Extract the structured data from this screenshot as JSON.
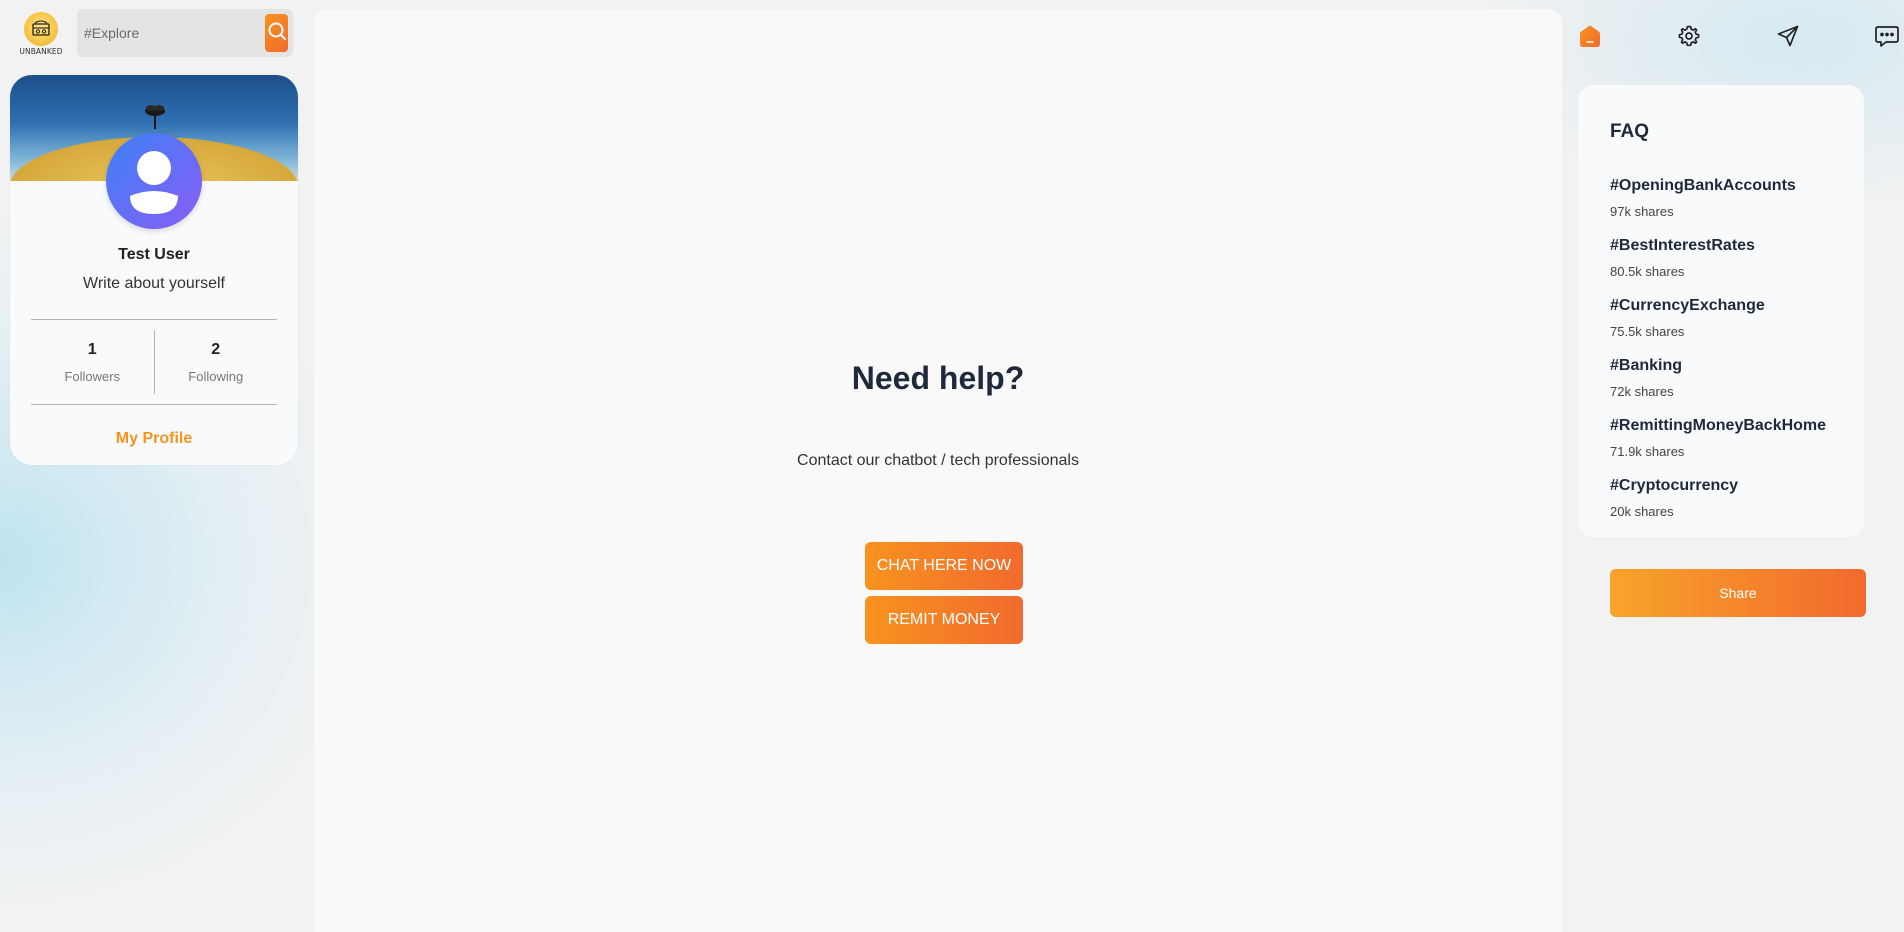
{
  "logo": {
    "text": "UNBANKED",
    "icon": "unbanked-logo"
  },
  "search": {
    "placeholder": "#Explore",
    "icon": "search-icon"
  },
  "profile": {
    "name": "Test User",
    "bio": "Write about yourself",
    "followers_count": "1",
    "followers_label": "Followers",
    "following_count": "2",
    "following_label": "Following",
    "link_label": "My Profile"
  },
  "main": {
    "title": "Need help?",
    "subtitle": "Contact our chatbot / tech professionals",
    "chat_button": "CHAT HERE NOW",
    "remit_button": "REMIT MONEY"
  },
  "top_icons": [
    "home-icon",
    "gear-icon",
    "send-icon",
    "chat-bubble-icon"
  ],
  "faq": {
    "title": "FAQ",
    "items": [
      {
        "tag": "#OpeningBankAccounts",
        "shares": "97k shares"
      },
      {
        "tag": "#BestInterestRates",
        "shares": "80.5k shares"
      },
      {
        "tag": "#CurrencyExchange",
        "shares": "75.5k shares"
      },
      {
        "tag": "#Banking",
        "shares": "72k shares"
      },
      {
        "tag": "#RemittingMoneyBackHome",
        "shares": "71.9k shares"
      },
      {
        "tag": "#Cryptocurrency",
        "shares": "20k shares"
      }
    ]
  },
  "share_button": "Share",
  "colors": {
    "accent": "#f7931e",
    "accent_end": "#f26a2e",
    "heading": "#1e293b"
  }
}
